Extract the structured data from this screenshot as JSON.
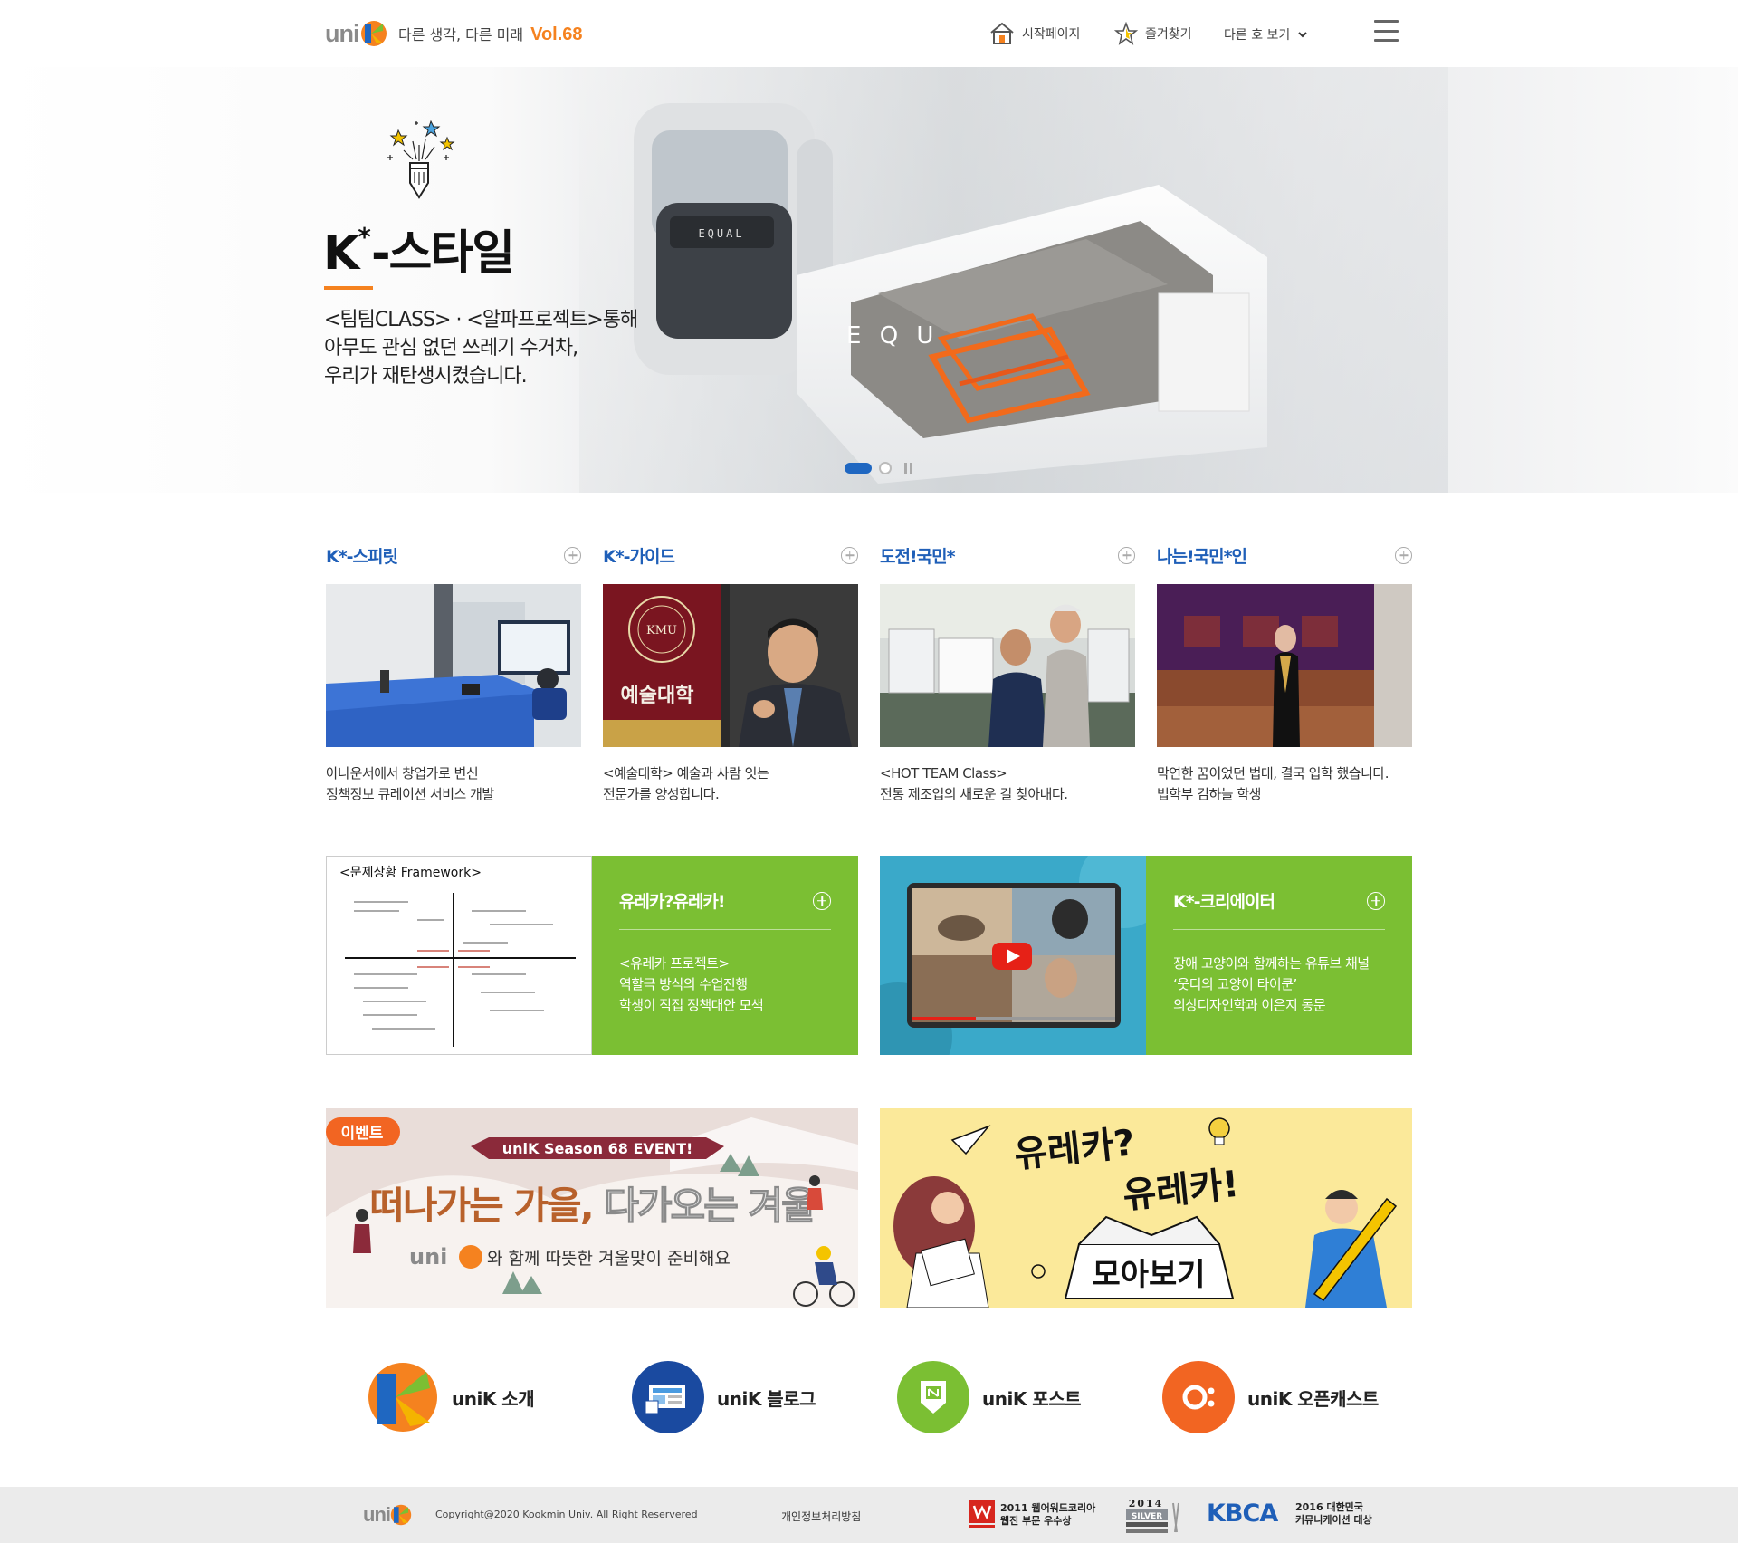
{
  "header": {
    "logo_text": "uni",
    "tagline": "다른 생각, 다른 미래",
    "volume": "Vol.68",
    "nav": {
      "home_label": "시작페이지",
      "favorite_label": "즐겨찾기",
      "other_issue_label": "다른 호 보기"
    }
  },
  "hero": {
    "title_k": "K",
    "title_star": "*",
    "title_rest": "-스타일",
    "desc_line1": "<팀팀CLASS> · <알파프로젝트>통해",
    "desc_line2": "아무도 관심 없던 쓰레기 수거차,",
    "desc_line3": "우리가 재탄생시켰습니다.",
    "image_text_equal": "EQUAL",
    "image_text_equ": "E Q U"
  },
  "cards": [
    {
      "title": "K*-스피릿",
      "line1": "아나운서에서 창업가로 변신",
      "line2": "정책정보 큐레이션 서비스 개발"
    },
    {
      "title": "K*-가이드",
      "line1": "<예술대학> 예술과 사람 잇는",
      "line2": "전문가를 양성합니다.",
      "image_text": "예술대학",
      "image_badge": "KMU"
    },
    {
      "title": "도전!국민*",
      "line1": "<HOT TEAM Class>",
      "line2": "전통 제조업의 새로운 길 찾아내다."
    },
    {
      "title": "나는!국민*인",
      "line1": "막연한 꿈이었던 법대, 결국 입학 했습니다.",
      "line2": "법학부 김하늘 학생"
    }
  ],
  "features": [
    {
      "title": "유레카?유레카!",
      "line1": "<유레카 프로젝트>",
      "line2": "역할극 방식의 수업진행",
      "line3": "학생이 직접 정책대안 모색",
      "image_text": "<문제상황 Framework>"
    },
    {
      "title": "K*-크리에이터",
      "line1": "장애 고양이와 함께하는 유튜브 채널",
      "line2": "‘웃디의 고양이 타이쿤’",
      "line3": "의상디자인학과 이은지 동문"
    }
  ],
  "banners": {
    "event": {
      "badge": "이벤트",
      "ribbon": "uniK Season 68 EVENT!",
      "headline_a": "떠나가는 가을,",
      "headline_b": "다가오는 겨울",
      "sub_logo": "uni",
      "sub_text": "와 함께 따뜻한 겨울맞이 준비해요"
    },
    "eureka": {
      "line1": "유레카?",
      "line2": "유레카!",
      "box_text": "모아보기"
    }
  },
  "bottom_links": [
    {
      "label": "uniK 소개",
      "color": "#ffffff"
    },
    {
      "label": "uniK 블로그",
      "color": "#1a4aa0"
    },
    {
      "label": "uniK 포스트",
      "color": "#7bbf33"
    },
    {
      "label": "uniK 오픈캐스트",
      "color": "#f26522"
    }
  ],
  "footer": {
    "logo_text": "uni",
    "copyright": "Copyright@2020 Kookmin Univ. All Right Reservered",
    "privacy": "개인정보처리방침",
    "award1_line1": "2011 웹어워드코리아",
    "award1_line2": "웹진 부문 우수상",
    "award2_year": "2014",
    "award2_text": "SILVER",
    "award3_logo": "KBCA",
    "award3_line1": "2016 대한민국",
    "award3_line2": "커뮤니케이션 대상"
  },
  "colors": {
    "brand_orange": "#f5821f",
    "brand_blue": "#1f5fb8",
    "feature_green": "#7bbf33",
    "footer_bg": "#ebebeb"
  }
}
